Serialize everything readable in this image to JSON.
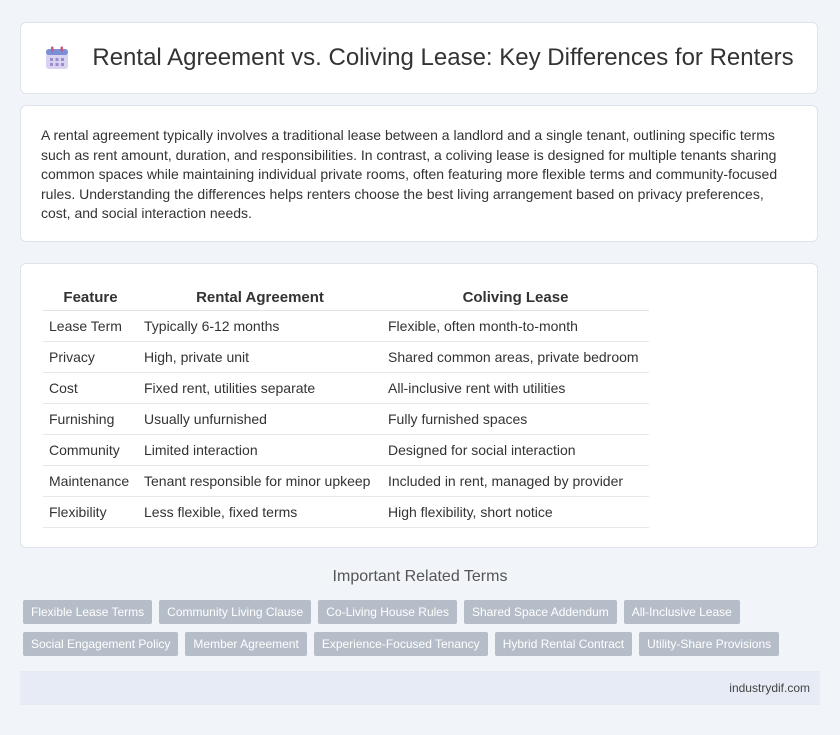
{
  "header": {
    "title": "Rental Agreement vs. Coliving Lease: Key Differences for Renters",
    "icon": "calendar-icon"
  },
  "intro": {
    "text": "A rental agreement typically involves a traditional lease between a landlord and a single tenant, outlining specific terms such as rent amount, duration, and responsibilities. In contrast, a coliving lease is designed for multiple tenants sharing common spaces while maintaining individual private rooms, often featuring more flexible terms and community-focused rules. Understanding the differences helps renters choose the best living arrangement based on privacy preferences, cost, and social interaction needs."
  },
  "table": {
    "headers": [
      "Feature",
      "Rental Agreement",
      "Coliving Lease"
    ],
    "rows": [
      [
        "Lease Term",
        "Typically 6-12 months",
        "Flexible, often month-to-month"
      ],
      [
        "Privacy",
        "High, private unit",
        "Shared common areas, private bedroom"
      ],
      [
        "Cost",
        "Fixed rent, utilities separate",
        "All-inclusive rent with utilities"
      ],
      [
        "Furnishing",
        "Usually unfurnished",
        "Fully furnished spaces"
      ],
      [
        "Community",
        "Limited interaction",
        "Designed for social interaction"
      ],
      [
        "Maintenance",
        "Tenant responsible for minor upkeep",
        "Included in rent, managed by provider"
      ],
      [
        "Flexibility",
        "Less flexible, fixed terms",
        "High flexibility, short notice"
      ]
    ]
  },
  "related": {
    "title": "Important Related Terms",
    "tags_row1": [
      "Flexible Lease Terms",
      "Community Living Clause",
      "Co-Living House Rules",
      "Shared Space Addendum",
      "All-Inclusive Lease"
    ],
    "tags_row2": [
      "Social Engagement Policy",
      "Member Agreement",
      "Experience-Focused Tenancy",
      "Hybrid Rental Contract",
      "Utility-Share Provisions"
    ]
  },
  "footer": {
    "text": "industrydif.com"
  },
  "colors": {
    "background": "#f1f4f9",
    "tag": "#b5bdc8",
    "footer": "#e6ebf5"
  }
}
